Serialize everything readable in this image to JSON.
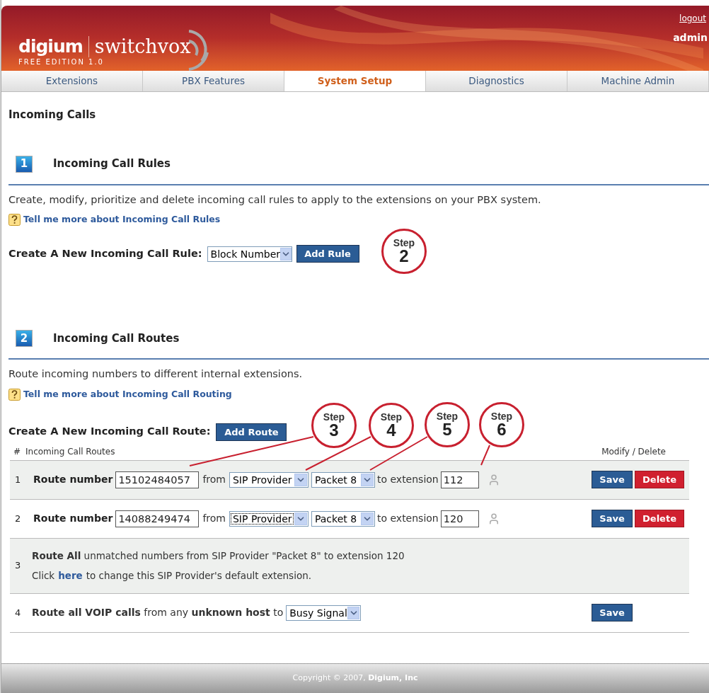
{
  "header": {
    "brand": "digium",
    "product": "switchvox",
    "edition": "FREE EDITION 1.0",
    "logout": "logout",
    "user": "admin"
  },
  "nav_tabs": [
    {
      "label": "Extensions",
      "selected": false
    },
    {
      "label": "PBX Features",
      "selected": false
    },
    {
      "label": "System Setup",
      "selected": true
    },
    {
      "label": "Diagnostics",
      "selected": false
    },
    {
      "label": "Machine Admin",
      "selected": false
    }
  ],
  "page_title": "Incoming Calls",
  "rules_section": {
    "number": "1",
    "title": "Incoming Call Rules",
    "description": "Create, modify, prioritize and delete incoming call rules to apply to the extensions on your PBX system.",
    "help_link": "Tell me more about Incoming Call Rules",
    "create_label": "Create A New Incoming Call Rule:",
    "select_value": "Block Number",
    "button": "Add Rule"
  },
  "routes_section": {
    "number": "2",
    "title": "Incoming Call Routes",
    "description": "Route incoming numbers to different internal extensions.",
    "help_link": "Tell me more about Incoming Call Routing",
    "create_label": "Create A New Incoming Call Route:",
    "button": "Add Route",
    "columns": [
      "#",
      "Incoming Call Routes",
      "Modify / Delete"
    ],
    "rows": [
      {
        "kind": "route",
        "index": "1",
        "label": "Route number",
        "number": "15102484057",
        "from_label": "from",
        "provider": "SIP Provider",
        "focused": false,
        "account": "Packet 8",
        "to_label": "to extension",
        "extension": "112",
        "save": "Save",
        "delete": "Delete"
      },
      {
        "kind": "route",
        "index": "2",
        "label": "Route number",
        "number": "14088249474",
        "from_label": "from",
        "provider": "SIP Provider",
        "focused": true,
        "account": "Packet 8",
        "to_label": "to extension",
        "extension": "120",
        "save": "Save",
        "delete": "Delete"
      },
      {
        "kind": "default",
        "index": "3",
        "line1": "**Route All** unmatched numbers from SIP Provider \"Packet 8\" to extension 120",
        "before_link": "Click",
        "link": "here",
        "after_link": "to change this SIP Provider's default extension."
      },
      {
        "kind": "voip",
        "index": "4",
        "text": "**Route all VOIP calls** from any **unknown host** to",
        "select_value": "Busy Signal",
        "save": "Save"
      }
    ]
  },
  "step_callouts": [
    {
      "label": "Step",
      "number": "2"
    },
    {
      "label": "Step",
      "number": "3"
    },
    {
      "label": "Step",
      "number": "4"
    },
    {
      "label": "Step",
      "number": "5"
    },
    {
      "label": "Step",
      "number": "6"
    }
  ],
  "footer": {
    "text": "Copyright © 2007, **Digium, Inc**"
  }
}
